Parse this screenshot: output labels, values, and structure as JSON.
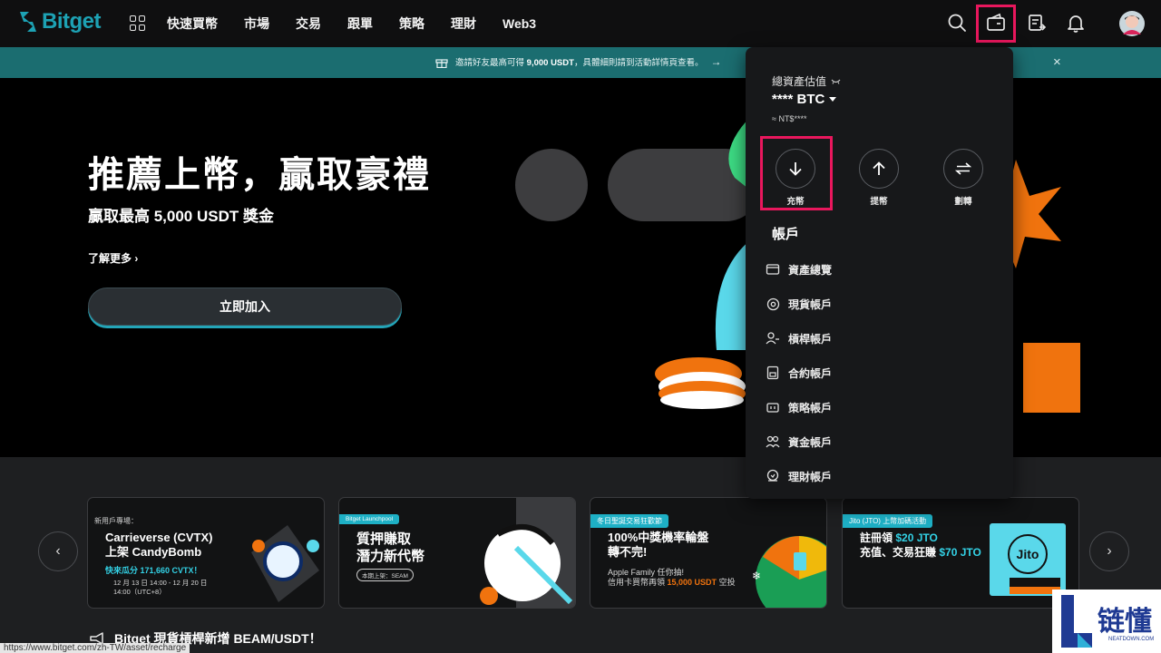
{
  "nav": {
    "brand": "Bitget",
    "items": [
      "快速買幣",
      "市場",
      "交易",
      "跟單",
      "策略",
      "理財",
      "Web3"
    ]
  },
  "promo": {
    "text_before": "邀請好友最高可得",
    "amount": "9,000 USDT",
    "text_after": "，具體細則請到活動詳情頁查看。",
    "arrow": "→",
    "close": "×"
  },
  "hero": {
    "title": "推薦上幣，贏取豪禮",
    "subtitle": "贏取最高 5,000 USDT 獎金",
    "more": "了解更多",
    "cta": "立即加入"
  },
  "assets": {
    "label": "總資產估值",
    "value": "**** BTC",
    "fiat": "≈ NT$****",
    "actions": [
      {
        "label": "充幣"
      },
      {
        "label": "提幣"
      },
      {
        "label": "劃轉"
      }
    ],
    "section_title": "帳戶",
    "accounts": [
      "資產總覽",
      "現貨帳戶",
      "槓桿帳戶",
      "合約帳戶",
      "策略帳戶",
      "資金帳戶",
      "理財帳戶"
    ]
  },
  "cards": [
    {
      "tag": "新用戶專場：",
      "title_l1": "Carrieverse (CVTX)",
      "title_l2": "上架 CandyBomb",
      "line1": "快來瓜分 171,660 CVTX！",
      "line2": "12 月 13 日 14:00 - 12 月 20 日",
      "line3": "14:00（UTC+8）"
    },
    {
      "tag": "Bitget Launchpool",
      "title_l1": "質押賺取",
      "title_l2": "潛力新代幣",
      "line1": "本期上架：SEAM"
    },
    {
      "tag": "冬日聖誕交易狂歡節",
      "title_l1": "100%中獎機率輪盤",
      "title_l2": "轉不完!",
      "line1": "Apple Family 任你抽!",
      "line2": "信用卡買幣再領",
      "line2_accent": "15,000 USDT",
      "line2_end": "空投"
    },
    {
      "tag": "Jito (JTO) 上幣加碼活動",
      "title_l1": "註冊領",
      "title_l1_accent": "$20 JTO",
      "title_l2": "充值、交易狂賺",
      "title_l2_accent": "$70 JTO",
      "logo": "Jito"
    }
  ],
  "news": "Bitget 現貨槓桿新增 BEAM/USDT！",
  "status_url": "https://www.bitget.com/zh-TW/asset/recharge",
  "watermark": {
    "text": "链懂",
    "sub": "NEATDOWN.COM"
  },
  "colors": {
    "brand": "#1da2b4",
    "highlight": "#e9175d",
    "banner": "#1b6d70",
    "accent_orange": "#f0730e",
    "accent_green": "#3ddc84",
    "accent_cyan": "#5ad8ea"
  }
}
